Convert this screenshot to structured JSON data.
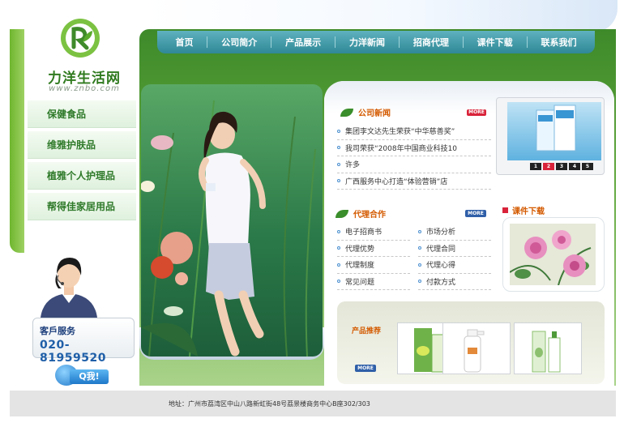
{
  "logo": {
    "name": "力洋生活网",
    "url_text": "www.znbo.com"
  },
  "sidebar": {
    "items": [
      {
        "label": "保健食品"
      },
      {
        "label": "维雅护肤品"
      },
      {
        "label": "植雅个人护理品"
      },
      {
        "label": "帮得佳家居用品"
      }
    ]
  },
  "service": {
    "label": "客戶服务",
    "phone": "020-81959520",
    "qq_label": "Q我!"
  },
  "nav": {
    "items": [
      {
        "label": "首页"
      },
      {
        "label": "公司简介"
      },
      {
        "label": "产品展示"
      },
      {
        "label": "力洋新闻"
      },
      {
        "label": "招商代理"
      },
      {
        "label": "课件下载"
      },
      {
        "label": "联系我们"
      }
    ]
  },
  "company_news": {
    "title": "公司新闻",
    "more": "MORE",
    "items": [
      {
        "text": "集团李文达先生荣获“中华慈善奖”"
      },
      {
        "text": "我司荣获“2008年中国商业科技10"
      },
      {
        "text": "许多"
      },
      {
        "text": "广西服务中心打造“体验营销”店"
      }
    ]
  },
  "showcase": {
    "pages": [
      "1",
      "2",
      "3",
      "4",
      "5"
    ],
    "active_page": "2"
  },
  "agency": {
    "title": "代理合作",
    "more": "MORE",
    "items": [
      {
        "text": "电子招商书"
      },
      {
        "text": "市场分析"
      },
      {
        "text": "代理优势"
      },
      {
        "text": "代理合同"
      },
      {
        "text": "代理制度"
      },
      {
        "text": "代理心得"
      },
      {
        "text": "常见问题"
      },
      {
        "text": "付款方式"
      }
    ]
  },
  "downloads": {
    "title": "课件下载"
  },
  "products": {
    "label": "产品推荐",
    "more": "MORE"
  },
  "footer": {
    "address": "地址：广州市荔湾区中山八路新虹街48号荔景楼商务中心B座302/303"
  },
  "colors": {
    "brand_green": "#3e8a2a",
    "nav_teal": "#2f8896",
    "accent_orange": "#d45a00",
    "more_red": "#d9233a",
    "more_blue": "#2f5fa8"
  }
}
